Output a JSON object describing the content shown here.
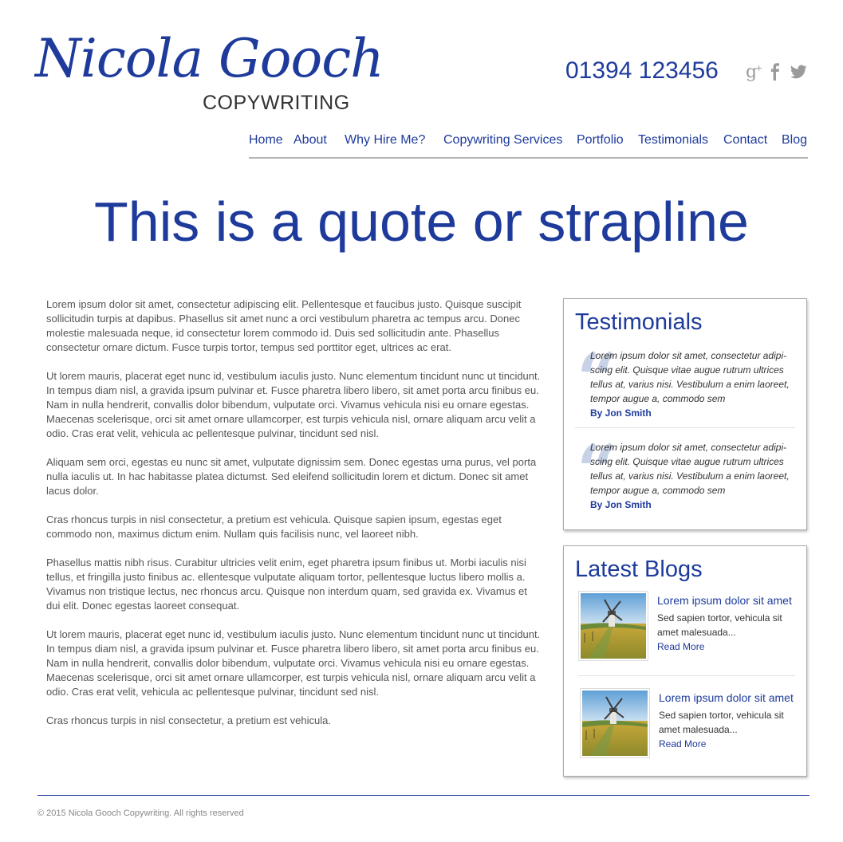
{
  "header": {
    "logo_name": "Nicola Gooch",
    "logo_sub": "COPYWRITING",
    "phone": "01394 123456",
    "social_icons": [
      "google-plus-icon",
      "facebook-icon",
      "twitter-icon"
    ]
  },
  "nav": {
    "items": [
      "Home",
      "About",
      "Why Hire Me?",
      "Copywriting Services",
      "Portfolio",
      "Testimonials",
      "Contact",
      "Blog"
    ]
  },
  "strapline": "This is a quote or strapline",
  "content": {
    "paragraphs": [
      "Lorem ipsum dolor sit amet, consectetur adipiscing elit. Pellentesque et faucibus justo. Quisque suscipit sollicitudin turpis at dapibus. Phasellus sit amet nunc a orci vestibulum pharetra ac tempus arcu. Donec molestie malesuada neque, id consectetur lorem commodo id. Duis sed sollicitudin ante. Phasellus consectetur ornare dictum. Fusce turpis tortor, tempus sed porttitor eget, ultrices ac erat.",
      "Ut lorem mauris, placerat eget nunc id, vestibulum iaculis justo. Nunc elementum tincidunt nunc ut tincidunt. In tempus diam nisl, a gravida ipsum pulvinar et. Fusce pharetra libero libero, sit amet porta arcu finibus eu. Nam in nulla hendrerit, convallis dolor bibendum, vulputate orci. Vivamus vehicula nisi eu ornare egestas. Maecenas scelerisque, orci sit amet ornare ullamcorper, est turpis vehicula nisl, ornare aliquam arcu velit a odio. Cras erat velit, vehicula ac pellentesque pulvinar, tincidunt sed nisl.",
      "Aliquam sem orci, egestas eu nunc sit amet, vulputate dignissim sem. Donec egestas urna purus, vel porta nulla iaculis ut. In hac habitasse platea dictumst. Sed eleifend sollicitudin lorem et dictum. Donec sit amet lacus dolor.",
      "Cras rhoncus turpis in nisl consectetur, a pretium est vehicula. Quisque sapien ipsum, egestas eget commodo non, maximus dictum enim. Nullam quis facilisis nunc, vel laoreet nibh.",
      "Phasellus mattis nibh risus. Curabitur ultricies velit enim, eget pharetra ipsum finibus ut. Morbi iaculis nisi tellus, et fringilla justo finibus ac. ellentesque vulputate aliquam tortor, pellentesque luctus libero mollis a. Vivamus non tristique lectus, nec rhoncus arcu. Quisque non interdum quam, sed gravida ex. Vivamus et dui elit. Donec egestas laoreet consequat.",
      "Ut lorem mauris, placerat eget nunc id, vestibulum iaculis justo. Nunc elementum tincidunt nunc ut tincidunt. In tempus diam nisl, a gravida ipsum pulvinar et. Fusce pharetra libero libero, sit amet porta arcu finibus eu. Nam in nulla hendrerit, convallis dolor bibendum, vulputate orci. Vivamus vehicula nisi eu ornare egestas. Maecenas scelerisque, orci sit amet ornare ullamcorper, est turpis vehicula nisl, ornare aliquam arcu velit a odio. Cras erat velit, vehicula ac pellentesque pulvinar, tincidunt sed nisl.",
      "Cras rhoncus turpis in nisl consectetur, a pretium est vehicula."
    ]
  },
  "testimonials": {
    "title": "Testimonials",
    "items": [
      {
        "text": "Lorem ipsum dolor sit amet, consectetur adipi-scing elit. Quisque vitae augue rutrum ultrices tellus at, varius nisi. Vestibulum a enim laoreet, tempor augue a, commodo sem",
        "author": "By Jon Smith"
      },
      {
        "text": "Lorem ipsum dolor sit amet, consectetur adipi-scing elit. Quisque vitae augue rutrum ultrices tellus at, varius nisi. Vestibulum a enim laoreet, tempor augue a, commodo sem",
        "author": "By Jon Smith"
      }
    ]
  },
  "blogs": {
    "title": "Latest Blogs",
    "items": [
      {
        "title": "Lorem ipsum dolor sit amet",
        "desc": "Sed sapien tortor, vehicula sit amet malesuada...",
        "more": "Read More"
      },
      {
        "title": "Lorem ipsum dolor sit amet",
        "desc": "Sed sapien tortor, vehicula sit amet malesuada...",
        "more": "Read More"
      }
    ]
  },
  "footer": {
    "copyright": "© 2015 Nicola Gooch Copywriting. All rights reserved"
  },
  "colors": {
    "brand": "#1e3b9c",
    "text": "#555555",
    "rule": "#b5b5b5"
  }
}
